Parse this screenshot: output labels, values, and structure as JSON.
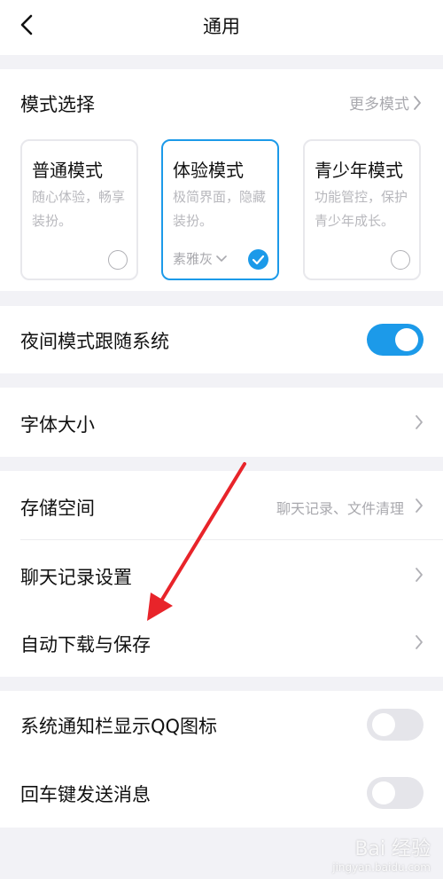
{
  "header": {
    "title": "通用",
    "back_icon": "chevron-left-icon"
  },
  "mode_section": {
    "title": "模式选择",
    "more_label": "更多模式",
    "cards": [
      {
        "title": "普通模式",
        "desc": "随心体验，畅享装扮。",
        "selected": false
      },
      {
        "title": "体验模式",
        "desc": "极简界面，隐藏装扮。",
        "selected": true,
        "theme_label": "素雅灰"
      },
      {
        "title": "青少年模式",
        "desc": "功能管控，保护青少年成长。",
        "selected": false
      }
    ]
  },
  "night_mode": {
    "label": "夜间模式跟随系统",
    "enabled": true
  },
  "font_size": {
    "label": "字体大小"
  },
  "storage": {
    "label": "存储空间",
    "value": "聊天记录、文件清理"
  },
  "chat_history": {
    "label": "聊天记录设置"
  },
  "auto_download": {
    "label": "自动下载与保存"
  },
  "notif_icon": {
    "label": "系统通知栏显示QQ图标",
    "enabled": false
  },
  "enter_send": {
    "label": "回车键发送消息",
    "enabled": false
  },
  "colors": {
    "accent": "#1c9ae9",
    "annotation_arrow": "#e8242a",
    "background": "#f2f2f6"
  },
  "watermark": {
    "text": "Bai 经验",
    "sub": "jingyan.baidu.com"
  }
}
